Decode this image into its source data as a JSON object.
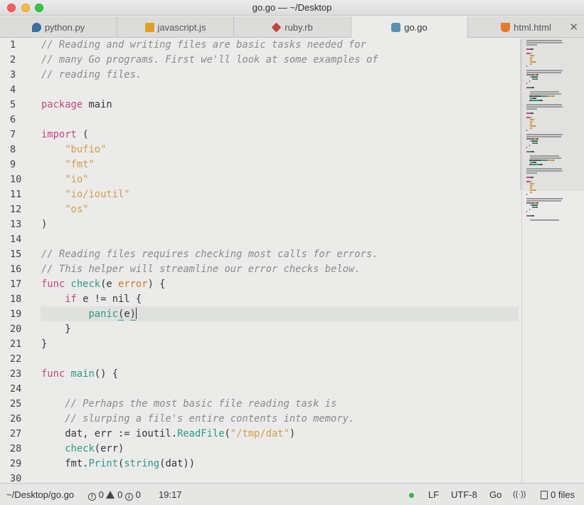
{
  "window": {
    "title": "go.go — ~/Desktop"
  },
  "tabs": [
    {
      "label": "python.py",
      "icon": "python-icon",
      "color": "#3c6e9e",
      "active": false
    },
    {
      "label": "javascript.js",
      "icon": "javascript-icon",
      "color": "#e0a028",
      "active": false
    },
    {
      "label": "ruby.rb",
      "icon": "ruby-icon",
      "color": "#c0453c",
      "active": false
    },
    {
      "label": "go.go",
      "icon": "go-icon",
      "color": "#5a8fb0",
      "active": true
    },
    {
      "label": "html.html",
      "icon": "html-icon",
      "color": "#e47a2e",
      "active": false
    }
  ],
  "tab_close": "✕",
  "editor": {
    "cursor_line": 19,
    "line_numbers": [
      "1",
      "2",
      "3",
      "4",
      "5",
      "6",
      "7",
      "8",
      "9",
      "10",
      "11",
      "12",
      "13",
      "14",
      "15",
      "16",
      "17",
      "18",
      "19",
      "20",
      "21",
      "22",
      "23",
      "24",
      "25",
      "26",
      "27",
      "28",
      "29",
      "30"
    ],
    "lines": [
      [
        [
          "cm",
          "// Reading and writing files are basic tasks needed for"
        ]
      ],
      [
        [
          "cm",
          "// many Go programs. First we'll look at some examples of"
        ]
      ],
      [
        [
          "cm",
          "// reading files."
        ]
      ],
      [],
      [
        [
          "kw",
          "package"
        ],
        [
          "",
          "main"
        ]
      ],
      [],
      [
        [
          "kw",
          "import"
        ],
        [
          "",
          " ("
        ]
      ],
      [
        [
          "",
          "    "
        ],
        [
          "st",
          "\"bufio\""
        ]
      ],
      [
        [
          "",
          "    "
        ],
        [
          "st",
          "\"fmt\""
        ]
      ],
      [
        [
          "",
          "    "
        ],
        [
          "st",
          "\"io\""
        ]
      ],
      [
        [
          "",
          "    "
        ],
        [
          "st",
          "\"io/ioutil\""
        ]
      ],
      [
        [
          "",
          "    "
        ],
        [
          "st",
          "\"os\""
        ]
      ],
      [
        [
          "",
          ")"
        ]
      ],
      [],
      [
        [
          "cm",
          "// Reading files requires checking most calls for errors."
        ]
      ],
      [
        [
          "cm",
          "// This helper will streamline our error checks below."
        ]
      ],
      [
        [
          "kw",
          "func"
        ],
        [
          "",
          ""
        ],
        [
          "fn",
          "check"
        ],
        [
          "",
          "(e "
        ],
        [
          "ty",
          "error"
        ],
        [
          "",
          ") {"
        ]
      ],
      [
        [
          "",
          "    "
        ],
        [
          "kw",
          "if"
        ],
        [
          "",
          " e != nil {"
        ]
      ],
      [
        [
          "",
          "        "
        ],
        [
          "fn",
          "panic"
        ],
        [
          "brk",
          "("
        ],
        [
          "",
          "e"
        ],
        [
          "brk",
          ")"
        ],
        [
          "caret",
          ""
        ]
      ],
      [
        [
          "",
          "    }"
        ]
      ],
      [
        [
          "",
          "}"
        ]
      ],
      [],
      [
        [
          "kw",
          "func"
        ],
        [
          "",
          ""
        ],
        [
          "fn",
          "main"
        ],
        [
          "",
          "() {"
        ]
      ],
      [],
      [
        [
          "",
          "    "
        ],
        [
          "cm",
          "// Perhaps the most basic file reading task is"
        ]
      ],
      [
        [
          "",
          "    "
        ],
        [
          "cm",
          "// slurping a file's entire contents into memory."
        ]
      ],
      [
        [
          "",
          "    dat, err := ioutil."
        ],
        [
          "fn",
          "ReadFile"
        ],
        [
          "",
          "("
        ],
        [
          "st",
          "\"/tmp/dat\""
        ],
        [
          "",
          ")"
        ]
      ],
      [
        [
          "",
          "    "
        ],
        [
          "fn",
          "check"
        ],
        [
          "",
          "(err)"
        ]
      ],
      [
        [
          "",
          "    fmt."
        ],
        [
          "fn",
          "Print"
        ],
        [
          "",
          "("
        ],
        [
          "fn",
          "string"
        ],
        [
          "",
          "(dat))"
        ]
      ],
      []
    ]
  },
  "status": {
    "path": "~/Desktop/go.go",
    "errors": "0",
    "warnings": "0",
    "infos": "0",
    "cursor_position": "19:17",
    "line_ending": "LF",
    "encoding": "UTF-8",
    "grammar": "Go",
    "files": "0 files",
    "status_color": "#3bb34a"
  }
}
